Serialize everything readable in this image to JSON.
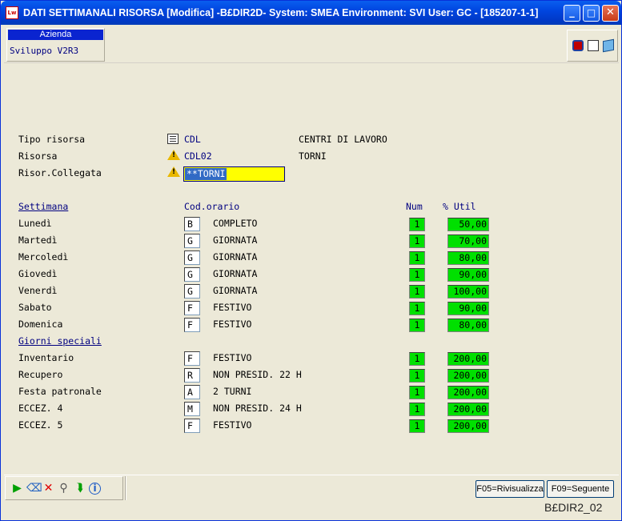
{
  "window": {
    "title": "DATI SETTIMANALI RISORSA [Modifica] -B£DIR2D- System: SMEA Environment: SVI User: GC - [185207-1-1]",
    "app_icon_text": "Lw",
    "minimize": "_",
    "maximize": "□",
    "close": "✕"
  },
  "azienda": {
    "label": "Azienda",
    "value": "Sviluppo V2R3"
  },
  "top_icons": [
    "monitor-icon",
    "document-icon",
    "book-icon"
  ],
  "header": {
    "tipo_risorsa": {
      "label": "Tipo risorsa",
      "code": "CDL",
      "description": "CENTRI DI LAVORO",
      "icon": "grid-icon"
    },
    "risorsa": {
      "label": "Risorsa",
      "code": "CDL02",
      "description": "TORNI",
      "icon": "warning-icon"
    },
    "risor_collegata": {
      "label": "Risor.Collegata",
      "value": "**TORNI",
      "icon": "warning-icon"
    }
  },
  "columns": {
    "settimana": "Settimana",
    "cod_orario": "Cod.orario",
    "num": "Num",
    "util": "% Util"
  },
  "settimana": [
    {
      "day": "Lunedì",
      "code": "B",
      "desc": "COMPLETO",
      "num": "1",
      "util": "50,00"
    },
    {
      "day": "Martedì",
      "code": "G",
      "desc": "GIORNATA",
      "num": "1",
      "util": "70,00"
    },
    {
      "day": "Mercoledì",
      "code": "G",
      "desc": "GIORNATA",
      "num": "1",
      "util": "80,00"
    },
    {
      "day": "Giovedì",
      "code": "G",
      "desc": "GIORNATA",
      "num": "1",
      "util": "90,00"
    },
    {
      "day": "Venerdì",
      "code": "G",
      "desc": "GIORNATA",
      "num": "1",
      "util": "100,00"
    },
    {
      "day": "Sabato",
      "code": "F",
      "desc": "FESTIVO",
      "num": "1",
      "util": "90,00"
    },
    {
      "day": "Domenica",
      "code": "F",
      "desc": "FESTIVO",
      "num": "1",
      "util": "80,00"
    }
  ],
  "giorni_speciali_title": "Giorni speciali",
  "giorni_speciali": [
    {
      "day": "Inventario",
      "code": "F",
      "desc": "FESTIVO",
      "num": "1",
      "util": "200,00"
    },
    {
      "day": "Recupero",
      "code": "R",
      "desc": "NON PRESID. 22 H",
      "num": "1",
      "util": "200,00"
    },
    {
      "day": "Festa patronale",
      "code": "A",
      "desc": "2 TURNI",
      "num": "1",
      "util": "200,00"
    },
    {
      "day": "ECCEZ. 4",
      "code": "M",
      "desc": "NON PRESID. 24 H",
      "num": "1",
      "util": "200,00"
    },
    {
      "day": "ECCEZ. 5",
      "code": "F",
      "desc": "FESTIVO",
      "num": "1",
      "util": "200,00"
    }
  ],
  "toolbar": {
    "play": "▶",
    "eraser": "⌫",
    "cancel": "✕",
    "find": "⚲",
    "next": "⮯",
    "info": "i"
  },
  "buttons": {
    "f05": "F05=Rivisualizza",
    "f09": "F09=Seguente"
  },
  "status": "B£DIR2_02",
  "colors": {
    "field_green": "#00E000",
    "selected_field": "#FFFF00",
    "title_blue": "#0046E0"
  }
}
